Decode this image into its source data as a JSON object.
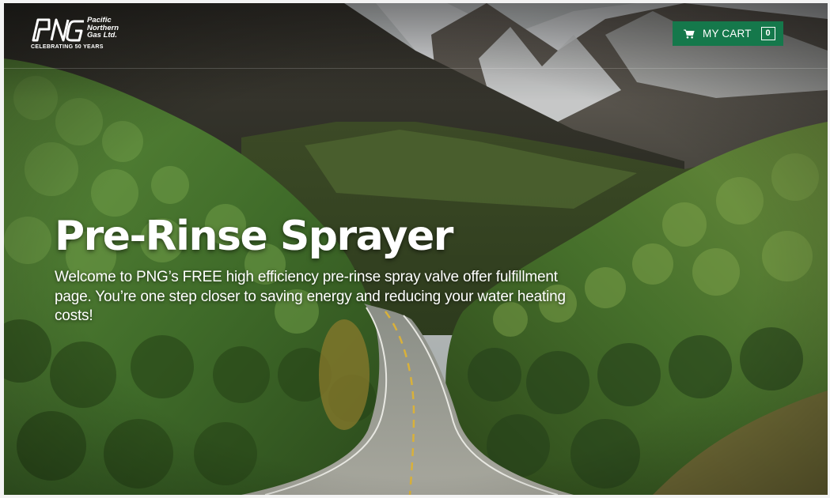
{
  "header": {
    "logo": {
      "mark_text": "PNG",
      "name_lines": "Pacific\nNorthern\nGas Ltd.",
      "tagline": "CELEBRATING 50 YEARS"
    },
    "cart": {
      "label": "MY CART",
      "count": "0",
      "icon": "shopping-cart-icon",
      "background_color": "#15784b"
    }
  },
  "hero": {
    "title": "Pre-Rinse Sprayer",
    "intro": "Welcome to PNG’s FREE high efficiency pre-rinse spray valve offer fulfillment page. You’re one step closer to saving energy and reducing your water heating costs!",
    "background_image": "mountain-road-forest-scene"
  }
}
